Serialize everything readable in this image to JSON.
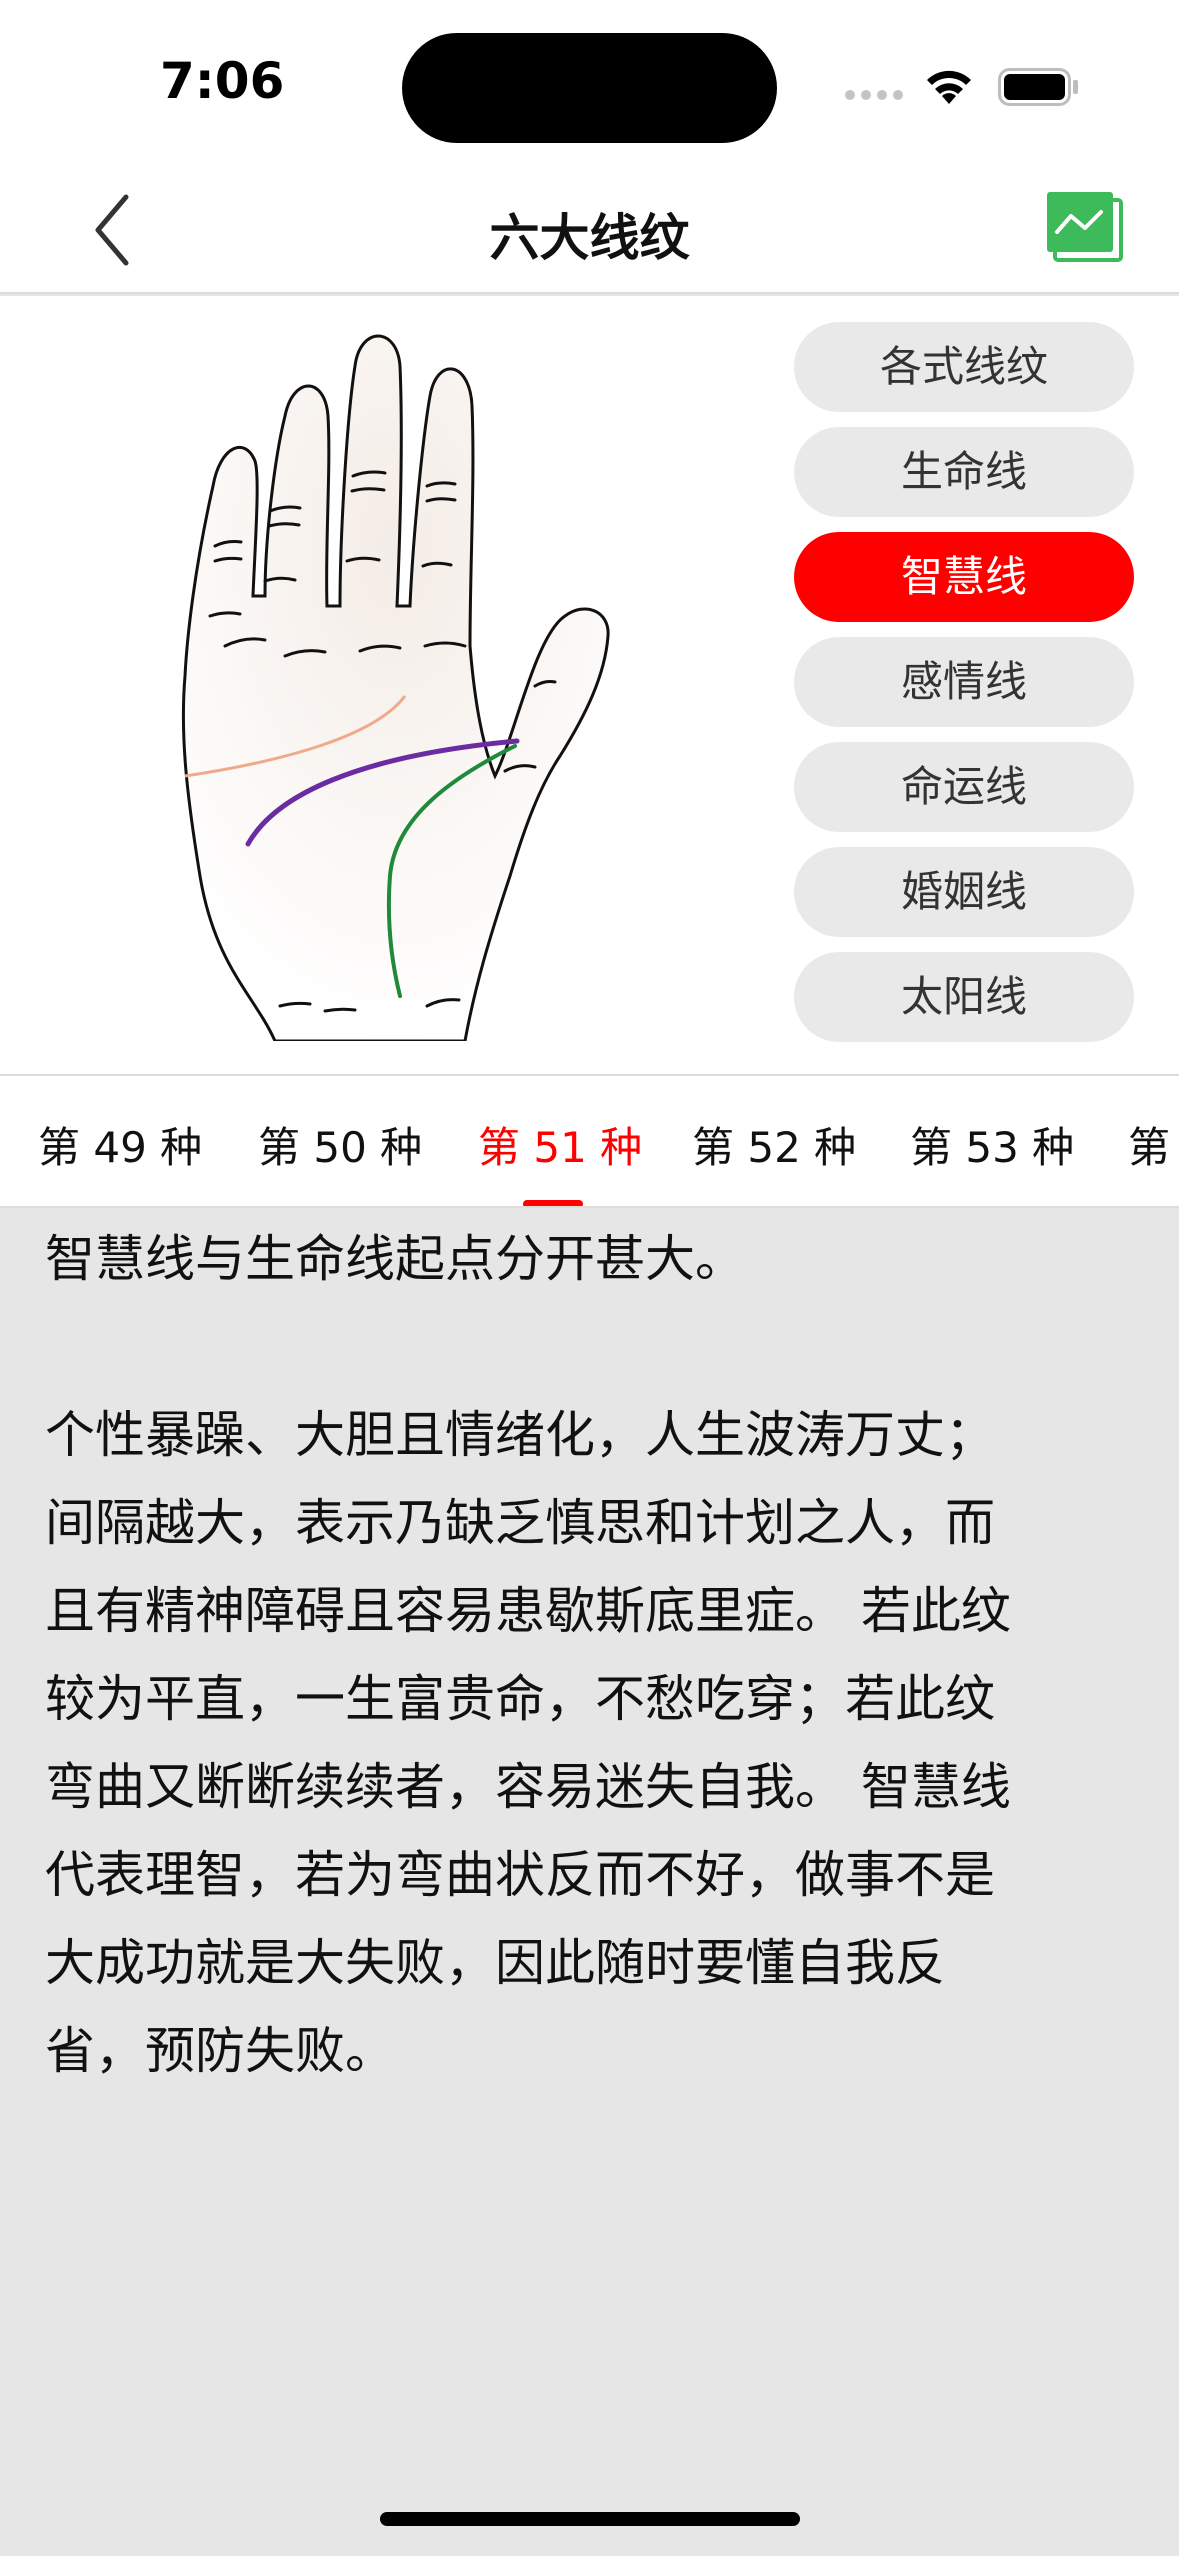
{
  "status_bar": {
    "time": "7:06"
  },
  "nav": {
    "title": "六大线纹",
    "back_icon": "chevron-left-icon",
    "right_icon": "line-chart-icon",
    "accent": "#3dbb5b"
  },
  "line_types": [
    {
      "label": "各式线纹",
      "active": false
    },
    {
      "label": "生命线",
      "active": false
    },
    {
      "label": "智慧线",
      "active": true
    },
    {
      "label": "感情线",
      "active": false
    },
    {
      "label": "命运线",
      "active": false
    },
    {
      "label": "婚姻线",
      "active": false
    },
    {
      "label": "太阳线",
      "active": false
    }
  ],
  "tabs": [
    {
      "label": "第 49 种",
      "active": false
    },
    {
      "label": "第 50 种",
      "active": false
    },
    {
      "label": "第 51 种",
      "active": true
    },
    {
      "label": "第 52 种",
      "active": false
    },
    {
      "label": "第 53 种",
      "active": false
    },
    {
      "label": "第",
      "active": false
    }
  ],
  "content": {
    "intro": "智慧线与生命线起点分开甚大。",
    "lines": [
      "个性暴躁、大胆且情绪化，人生波涛万丈；",
      "间隔越大，表示乃缺乏慎思和计划之人，而",
      "且有精神障碍且容易患歇斯底里症。 若此纹",
      "较为平直，一生富贵命，不愁吃穿；若此纹",
      "弯曲又断断续续者，容易迷失自我。 智慧线",
      "代表理智，若为弯曲状反而不好，做事不是",
      "大成功就是大失败，因此随时要懂自我反",
      "省，预防失败。"
    ]
  },
  "colors": {
    "active": "#ff0000",
    "pill": "#e9e9e9",
    "background": "#e6e6e6"
  }
}
